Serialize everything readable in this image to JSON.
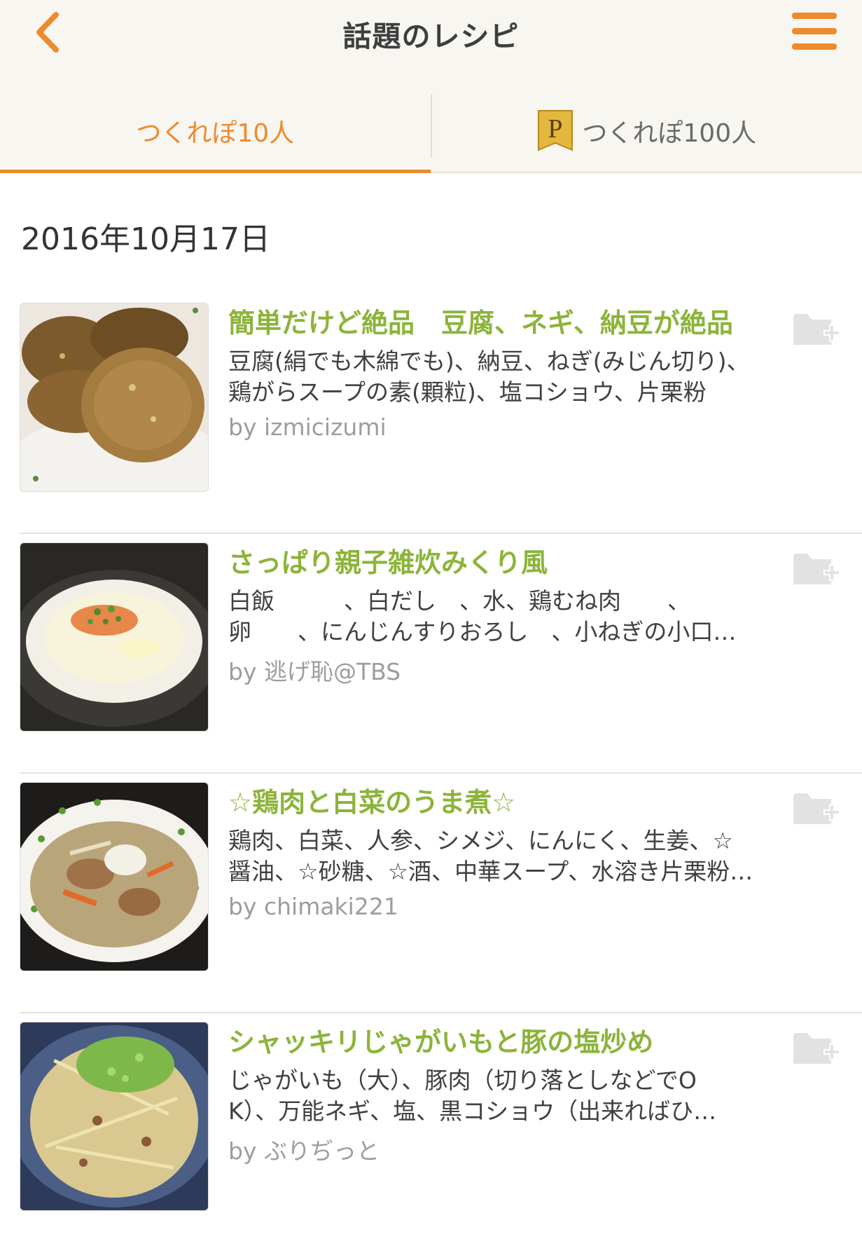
{
  "header": {
    "title": "話題のレシピ",
    "back_icon": "chevron-left-icon",
    "menu_icon": "hamburger-menu-icon"
  },
  "tabs": [
    {
      "label": "つくれぽ10人",
      "active": true
    },
    {
      "label": "つくれぽ100人",
      "active": false,
      "badge": "P"
    }
  ],
  "date_label": "2016年10月17日",
  "recipes": [
    {
      "title": "簡単だけど絶品　豆腐、ネギ、納豆が絶品",
      "ingredients_line1": "豆腐(絹でも木綿でも)、納豆、ねぎ(みじん切り)、",
      "ingredients_line2": "鶏がらスープの素(顆粒)、塩コショウ、片栗粉",
      "author": "by izmicizumi"
    },
    {
      "title": "さっぱり親子雑炊みくり風",
      "ingredients_line1": "白飯　　　、白だし　、水、鶏むね肉　　、",
      "ingredients_line2": "卵　　、にんじんすりおろし　、小ねぎの小口…",
      "author": "by 逃げ恥@TBS"
    },
    {
      "title": "☆鶏肉と白菜のうま煮☆",
      "ingredients_line1": "鶏肉、白菜、人参、シメジ、にんにく、生姜、☆",
      "ingredients_line2": "醤油、☆砂糖、☆酒、中華スープ、水溶き片栗粉…",
      "author": "by chimaki221"
    },
    {
      "title": "シャッキリじゃがいもと豚の塩炒め",
      "ingredients_line1": "じゃがいも（大）、豚肉（切り落としなどでO",
      "ingredients_line2": "K）、万能ネギ、塩、黒コショウ（出来ればひ…",
      "author": "by ぶりぢっと"
    }
  ],
  "colors": {
    "accent": "#ee8a2c",
    "recipe_title": "#8cb43a",
    "header_bg": "#f8f6f1",
    "author": "#9d9d9d"
  }
}
